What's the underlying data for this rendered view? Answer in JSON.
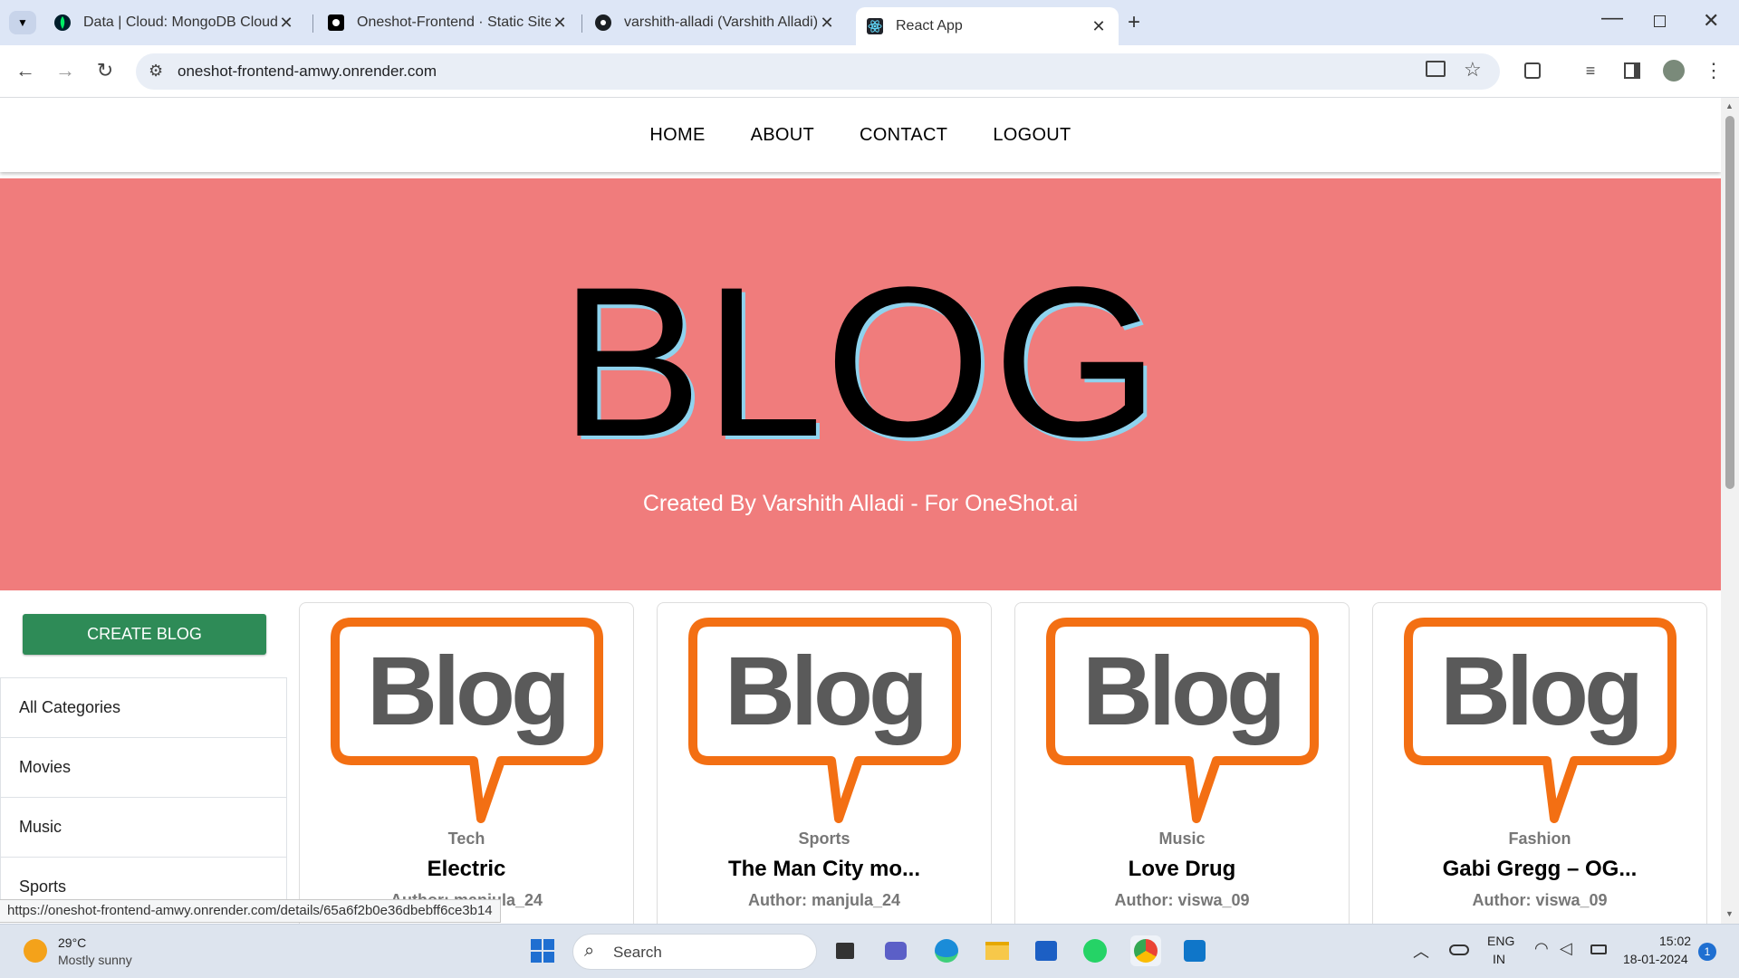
{
  "browser": {
    "tabs": [
      {
        "title": "Data | Cloud: MongoDB Cloud",
        "icon": "mongodb-leaf-icon"
      },
      {
        "title": "Oneshot-Frontend · Static Site",
        "icon": "render-icon"
      },
      {
        "title": "varshith-alladi (Varshith Alladi)",
        "icon": "github-icon"
      },
      {
        "title": "React App",
        "icon": "react-icon"
      }
    ],
    "url": "oneshot-frontend-amwy.onrender.com",
    "status_url": "https://oneshot-frontend-amwy.onrender.com/details/65a6f2b0e36dbebff6ce3b14"
  },
  "nav": {
    "home": "HOME",
    "about": "ABOUT",
    "contact": "CONTACT",
    "logout": "LOGOUT"
  },
  "hero": {
    "title": "BLOG",
    "subtitle": "Created By Varshith Alladi - For OneShot.ai"
  },
  "create_label": "CREATE BLOG",
  "categories": [
    "All Categories",
    "Movies",
    "Music",
    "Sports"
  ],
  "posts": [
    {
      "category": "Tech",
      "title": "Electric",
      "author": "Author: manjula_24",
      "image_text": "Blog"
    },
    {
      "category": "Sports",
      "title": "The Man City mo...",
      "author": "Author: manjula_24",
      "image_text": "Blog"
    },
    {
      "category": "Music",
      "title": "Love Drug",
      "author": "Author: viswa_09",
      "image_text": "Blog"
    },
    {
      "category": "Fashion",
      "title": "Gabi Gregg – OG...",
      "author": "Author: viswa_09",
      "image_text": "Blog"
    }
  ],
  "taskbar": {
    "temp": "29°C",
    "weather": "Mostly sunny",
    "search": "Search",
    "lang": "ENG",
    "region": "IN",
    "time": "15:02",
    "date": "18-01-2024",
    "notifications": "1"
  },
  "colors": {
    "hero": "#f07c7c",
    "create": "#2e8b57",
    "logo_orange": "#f36f13",
    "logo_gray": "#5a5a5a"
  }
}
